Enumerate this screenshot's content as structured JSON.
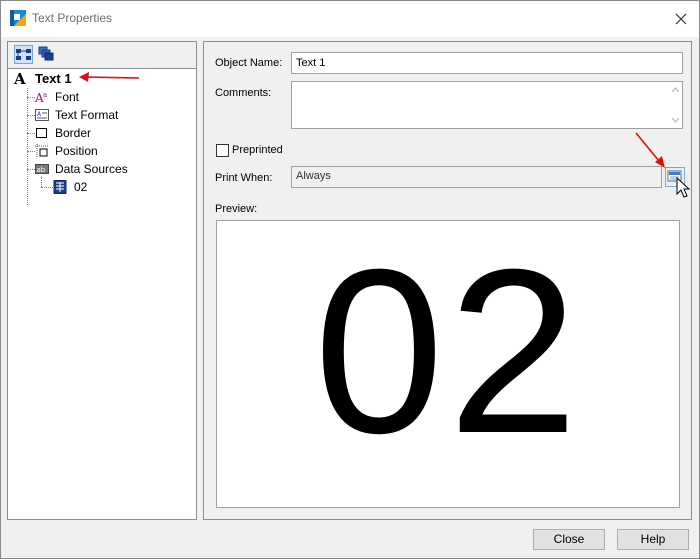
{
  "window": {
    "title": "Text Properties"
  },
  "tree": {
    "root": "Text 1",
    "items": [
      {
        "label": "Font"
      },
      {
        "label": "Text Format"
      },
      {
        "label": "Border"
      },
      {
        "label": "Position"
      },
      {
        "label": "Data Sources"
      }
    ],
    "datasource_child": "02"
  },
  "form": {
    "object_name_label": "Object Name:",
    "object_name_value": "Text 1",
    "comments_label": "Comments:",
    "comments_value": "",
    "preprinted_label": "Preprinted",
    "preprinted_checked": false,
    "print_when_label": "Print When:",
    "print_when_value": "Always",
    "preview_label": "Preview:"
  },
  "preview": {
    "text": "02"
  },
  "buttons": {
    "close": "Close",
    "help": "Help"
  },
  "colors": {
    "annotation_arrow": "#e01010",
    "accent": "#0f5fa8"
  }
}
